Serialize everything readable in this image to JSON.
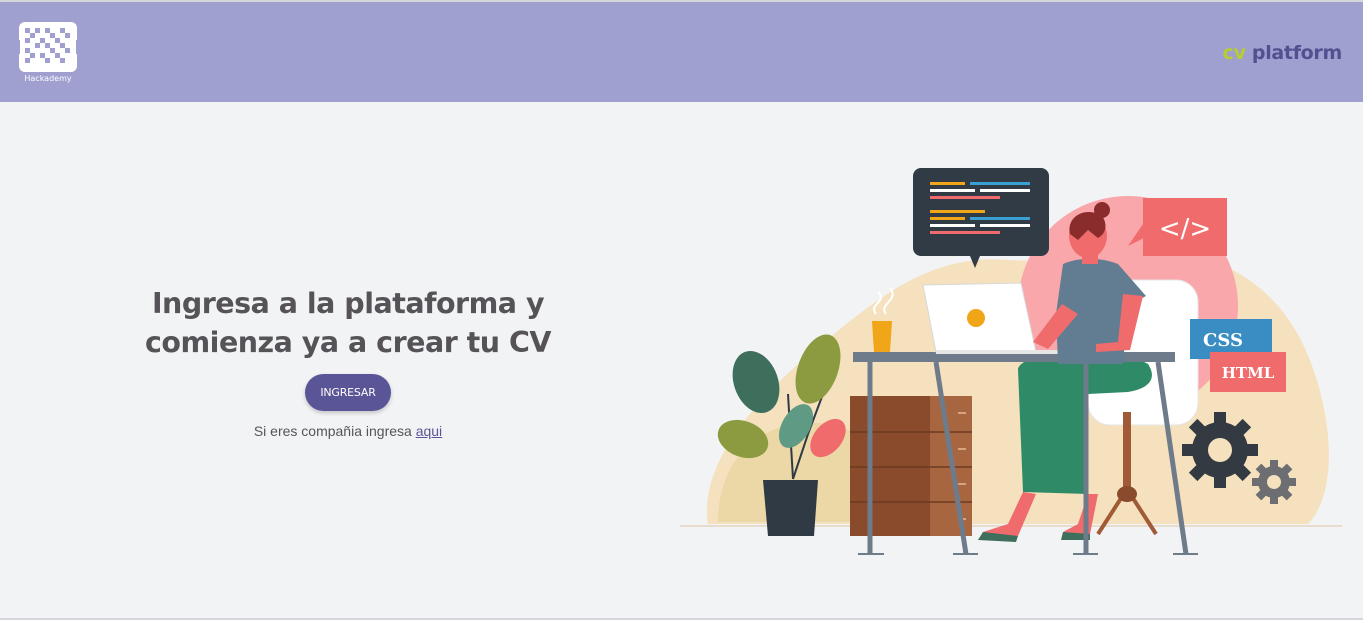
{
  "header": {
    "logo_text": "Hackademy",
    "brand_prefix": "cv",
    "brand_suffix": " platform",
    "background_color": "#9fa0cf",
    "brand_prefix_color": "#b7cf2e",
    "brand_suffix_color": "#52508f"
  },
  "hero": {
    "title_line1": "Ingresa a la plataforma y",
    "title_line2": "comienza ya a crear tu CV",
    "button_label": "INGRESAR",
    "button_color": "#5a5596",
    "company_text": "Si eres compañia ingresa ",
    "company_link": "aqui"
  },
  "illustration": {
    "badge_code": "</>",
    "badge_css": "CSS",
    "badge_html": "HTML"
  }
}
